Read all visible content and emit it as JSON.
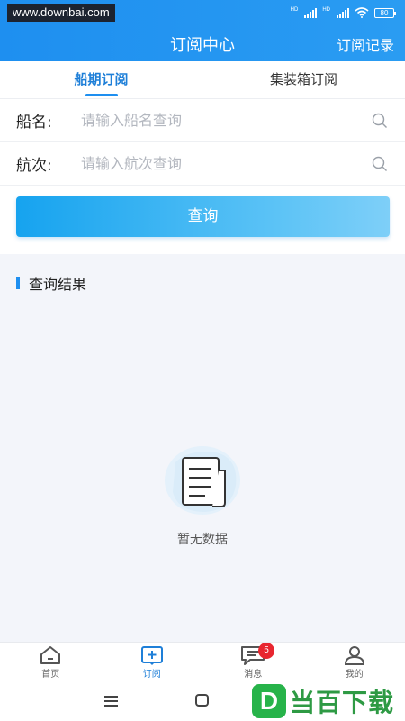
{
  "watermark_top": "www.downbai.com",
  "status": {
    "hd1": "HD",
    "hd2": "HD",
    "battery": "80"
  },
  "header": {
    "title": "订阅中心",
    "record_link": "订阅记录"
  },
  "tabs": [
    {
      "label": "船期订阅",
      "active": true
    },
    {
      "label": "集装箱订阅",
      "active": false
    }
  ],
  "form": {
    "ship_label": "船名:",
    "ship_placeholder": "请输入船名查询",
    "voyage_label": "航次:",
    "voyage_placeholder": "请输入航次查询",
    "query_button": "查询"
  },
  "results": {
    "title": "查询结果",
    "empty_text": "暂无数据"
  },
  "tabbar": [
    {
      "label": "首页",
      "icon": "home-icon",
      "active": false
    },
    {
      "label": "订阅",
      "icon": "subscribe-icon",
      "active": true
    },
    {
      "label": "消息",
      "icon": "message-icon",
      "active": false,
      "badge": "5"
    },
    {
      "label": "我的",
      "icon": "user-icon",
      "active": false
    }
  ],
  "watermark_logo": {
    "letter": "D",
    "text": "当百下载"
  },
  "colors": {
    "primary": "#1e8ff0",
    "badge": "#e8262f",
    "logo_green": "#27b34a"
  }
}
